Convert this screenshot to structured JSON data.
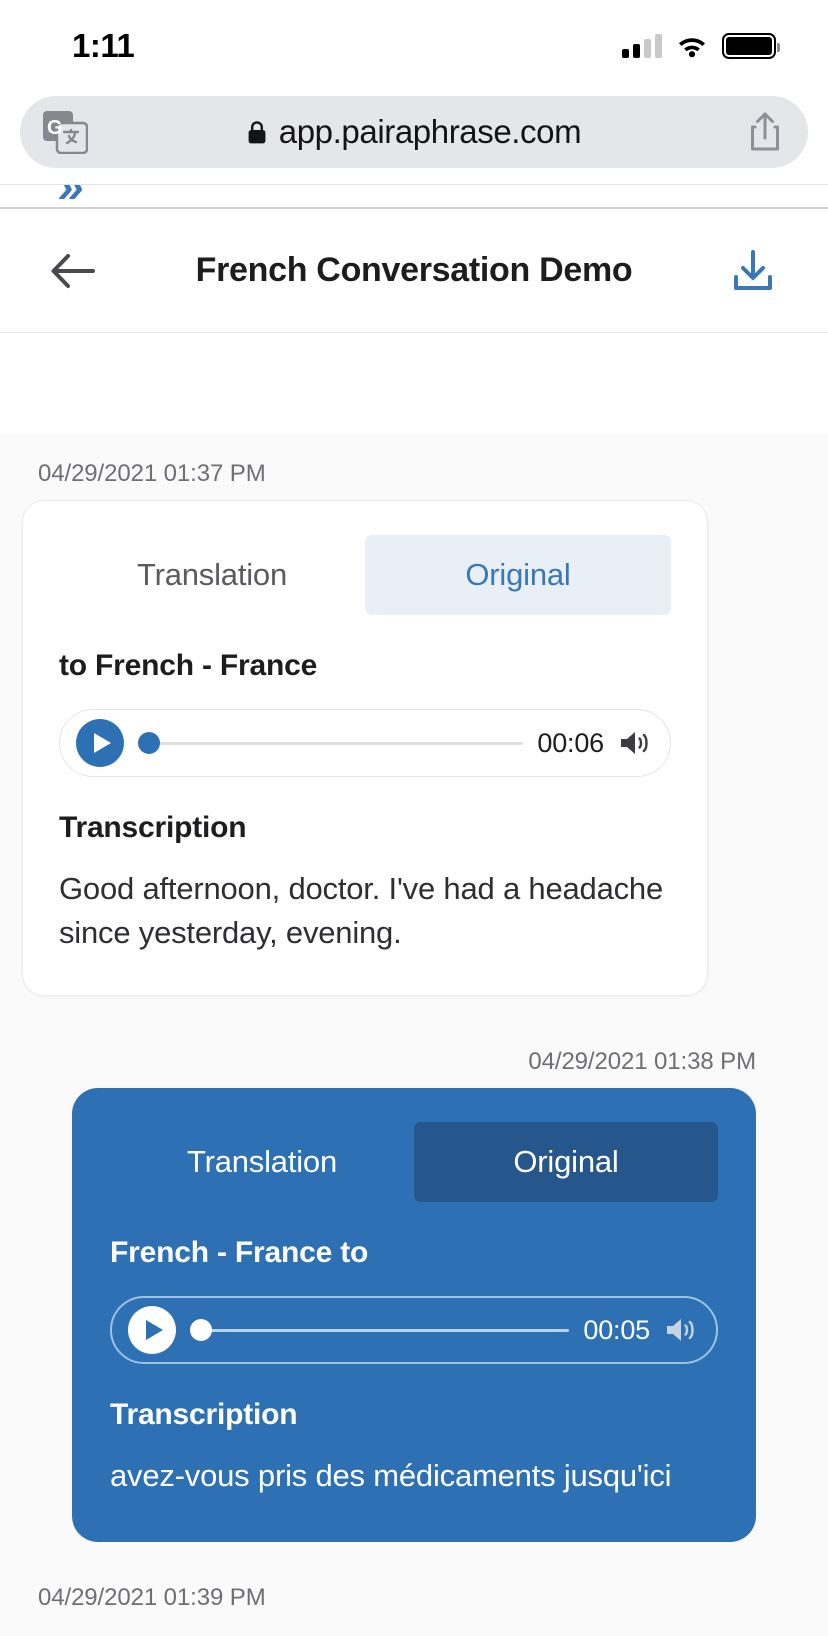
{
  "status_bar": {
    "time": "1:11",
    "signal_icon": "cellular-signal-icon",
    "wifi_icon": "wifi-icon",
    "battery_icon": "battery-full-icon"
  },
  "browser": {
    "translate_icon": "google-translate-icon",
    "lock_icon": "lock-icon",
    "url": "app.pairaphrase.com",
    "share_icon": "share-icon"
  },
  "page_sliver": {
    "logo_text": "»"
  },
  "app_header": {
    "back_icon": "back-arrow-icon",
    "title": "French Conversation Demo",
    "download_icon": "download-icon"
  },
  "colors": {
    "accent_blue": "#2d70b3",
    "link_blue": "#3a77b5",
    "tab_active_light_bg": "#e8eff7",
    "tab_active_dark_bg": "#25568c",
    "page_bg": "#fafafa",
    "card_white_bg": "#ffffff"
  },
  "messages": [
    {
      "timestamp": "04/29/2021 01:37 PM",
      "align": "left",
      "theme": "white",
      "tabs": [
        {
          "label": "Translation",
          "active": false
        },
        {
          "label": "Original",
          "active": true
        }
      ],
      "language_label": "to French - France",
      "player": {
        "play_icon": "play-icon",
        "duration": "00:06",
        "volume_icon": "volume-icon",
        "progress_percent": 0
      },
      "transcription_label": "Transcription",
      "transcription_text": "Good afternoon, doctor. I've had a headache since yesterday, evening."
    },
    {
      "timestamp": "04/29/2021 01:38 PM",
      "align": "right",
      "theme": "blue",
      "tabs": [
        {
          "label": "Translation",
          "active": false
        },
        {
          "label": "Original",
          "active": true
        }
      ],
      "language_label": "French - France to",
      "player": {
        "play_icon": "play-icon",
        "duration": "00:05",
        "volume_icon": "volume-icon",
        "progress_percent": 0
      },
      "transcription_label": "Transcription",
      "transcription_text": "avez-vous pris des médicaments jusqu'ici"
    }
  ],
  "trailing_timestamp": "04/29/2021 01:39 PM"
}
